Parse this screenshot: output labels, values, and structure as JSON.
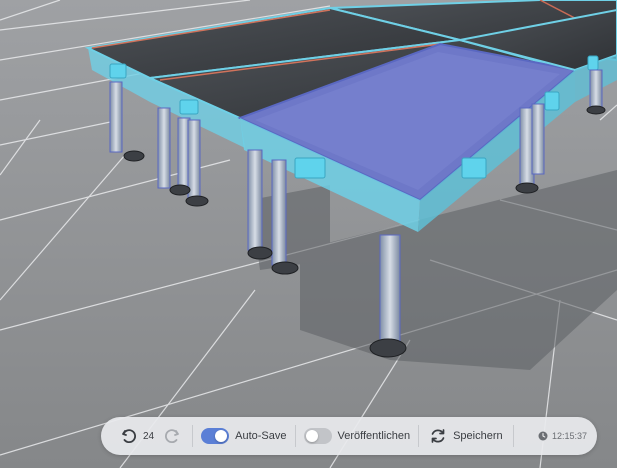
{
  "toolbar": {
    "undo_count": "24",
    "autosave_label": "Auto-Save",
    "autosave_on": true,
    "publish_label": "Veröffentlichen",
    "publish_on": false,
    "save_label": "Speichern",
    "time": "12:15:37",
    "icons": [
      "undo-icon",
      "redo-icon",
      "refresh-icon",
      "clock-icon"
    ]
  },
  "colors": {
    "accent": "#5b7fd6",
    "selection_highlight": "#6e78c8",
    "platform_frame": "#6fd0e6",
    "floor": "#8a8c8f"
  }
}
